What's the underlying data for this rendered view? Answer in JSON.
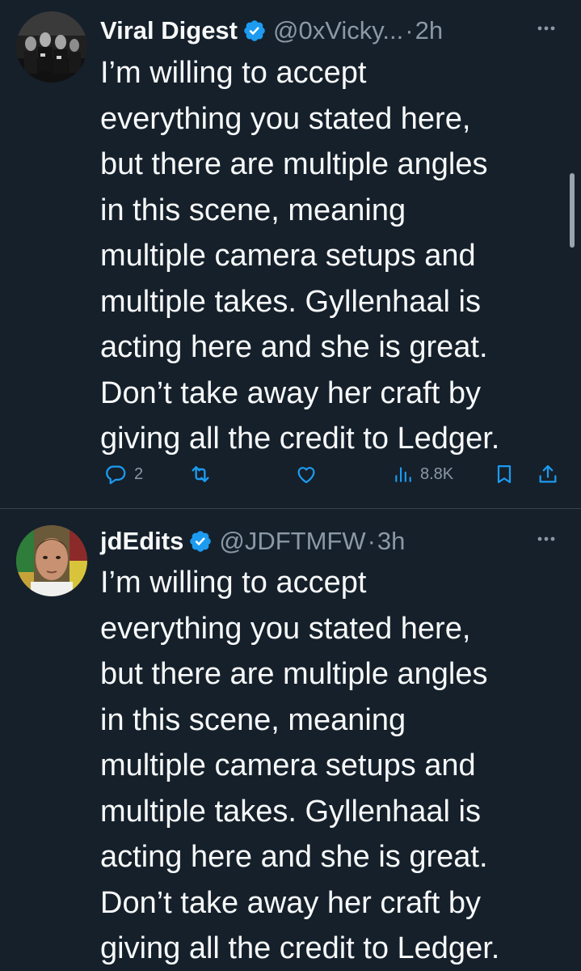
{
  "colors": {
    "background": "#15202b",
    "text_primary": "#f7f9f9",
    "text_secondary": "#8b98a5",
    "verified_badge": "#1d9bf0",
    "divider": "#38444d"
  },
  "tweets": [
    {
      "display_name": "Viral Digest",
      "handle": "@0xVicky...",
      "separator": "·",
      "time": "2h",
      "verified_icon": "verified-badge-icon",
      "more_icon": "more-options-icon",
      "text": "I’m willing to accept\neverything you stated here,\nbut there are multiple angles\nin this scene, meaning\nmultiple camera setups and\nmultiple takes. Gyllenhaal is\nacting here and she is great.\nDon’t take away her craft by\ngiving all the credit to Ledger.",
      "actions": {
        "reply_icon": "reply-icon",
        "reply_count": "2",
        "retweet_icon": "retweet-icon",
        "like_icon": "heart-icon",
        "views_icon": "views-chart-icon",
        "views_count": "8.8K",
        "bookmark_icon": "bookmark-icon",
        "share_icon": "share-icon"
      }
    },
    {
      "display_name": "jdEdits",
      "handle": "@JDFTMFW",
      "separator": "·",
      "time": "3h",
      "verified_icon": "verified-badge-icon",
      "more_icon": "more-options-icon",
      "text": "I’m willing to accept\neverything you stated here,\nbut there are multiple angles\nin this scene, meaning\nmultiple camera setups and\nmultiple takes. Gyllenhaal is\nacting here and she is great.\nDon’t take away her craft by\ngiving all the credit to Ledger."
    }
  ]
}
